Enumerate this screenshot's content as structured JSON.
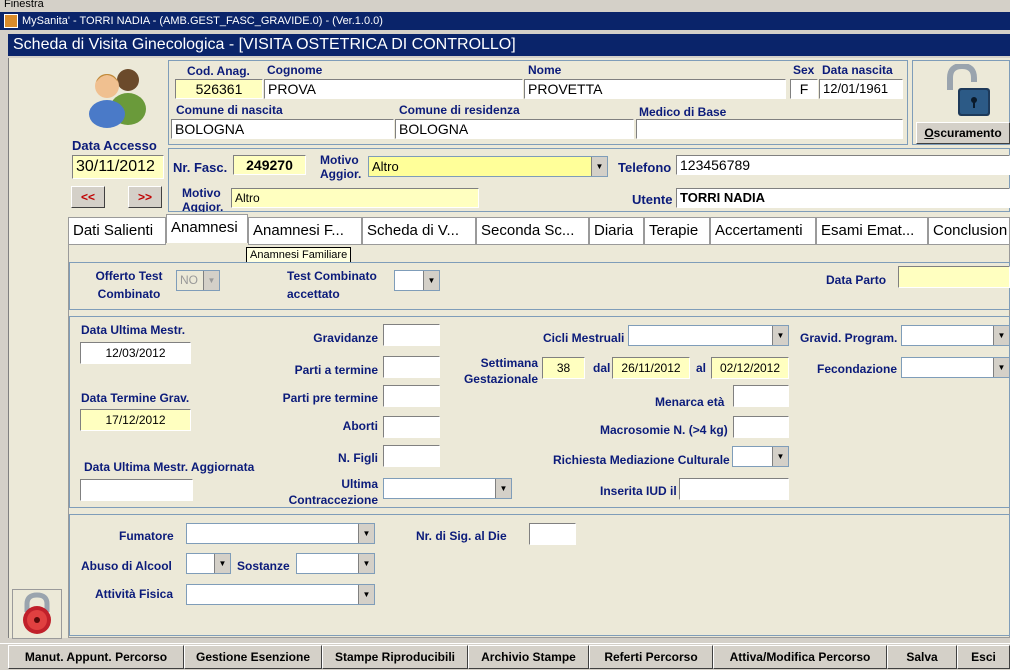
{
  "menu": {
    "first_item": "Finestra"
  },
  "window": {
    "title": "MySanita' - TORRI NADIA - (AMB.GEST_FASC_GRAVIDE.0) - (Ver.1.0.0)"
  },
  "form": {
    "title": "Scheda di Visita Ginecologica - [VISITA OSTETRICA DI CONTROLLO]"
  },
  "patient": {
    "cod_anag_label": "Cod. Anag.",
    "cod_anag": "526361",
    "cognome_label": "Cognome",
    "cognome": "PROVA",
    "nome_label": "Nome",
    "nome": "PROVETTA",
    "sex_label": "Sex",
    "sex": "F",
    "data_nascita_label": "Data nascita",
    "data_nascita": "12/01/1961",
    "comune_nascita_label": "Comune di nascita",
    "comune_nascita": "BOLOGNA",
    "comune_residenza_label": "Comune di residenza",
    "comune_residenza": "BOLOGNA",
    "medico_label": "Medico di Base",
    "medico": ""
  },
  "access": {
    "data_accesso_label": "Data Accesso",
    "data_accesso": "30/11/2012",
    "prev_label": "<<",
    "next_label": ">>"
  },
  "oscuramento": {
    "label": "Oscuramento",
    "underline": "O",
    "rest": "scuramento"
  },
  "fascicolo": {
    "nr_fasc_label": "Nr. Fasc.",
    "nr_fasc": "249270",
    "motivo_aggior_label": "Motivo Aggior.",
    "motivo_aggior_select": "Altro",
    "telefono_label": "Telefono",
    "telefono": "123456789",
    "motivo_aggior_text_label": "Motivo Aggior.",
    "motivo_aggior_text": "Altro",
    "utente_label": "Utente",
    "utente": "TORRI NADIA"
  },
  "tabs": [
    {
      "label": "Dati Salienti"
    },
    {
      "label": "Anamnesi"
    },
    {
      "label": "Anamnesi F..."
    },
    {
      "label": "Scheda di V..."
    },
    {
      "label": "Seconda Sc..."
    },
    {
      "label": "Diaria"
    },
    {
      "label": "Terapie"
    },
    {
      "label": "Accertamenti"
    },
    {
      "label": "Esami Emat..."
    },
    {
      "label": "Conclusion"
    }
  ],
  "tooltip": "Anamnesi Familiare",
  "section1": {
    "offerto_label": "Offerto Test Combinato",
    "offerto_value": "NO",
    "accettato_label": "Test Combinato accettato",
    "accettato_value": "",
    "data_parto_label": "Data Parto",
    "data_parto": ""
  },
  "section2": {
    "dum_label": "Data Ultima Mestr.",
    "dum": "12/03/2012",
    "dtg_label": "Data Termine Grav.",
    "dtg": "17/12/2012",
    "duma_label": "Data Ultima Mestr. Aggiornata",
    "duma": "",
    "gravidanze_label": "Gravidanze",
    "gravidanze": "",
    "parti_termine_label": "Parti a termine",
    "parti_termine": "",
    "parti_pre_label": "Parti pre termine",
    "parti_pre": "",
    "aborti_label": "Aborti",
    "aborti": "",
    "figli_label": "N. Figli",
    "figli": "",
    "contraccezione_label": "Ultima Contraccezione",
    "contraccezione": "",
    "cicli_label": "Cicli Mestruali",
    "cicli": "",
    "settimana_label": "Settimana Gestazionale",
    "settimana": "38",
    "dal_label": "dal",
    "dal": "26/11/2012",
    "al_label": "al",
    "al": "02/12/2012",
    "menarca_label": "Menarca età",
    "menarca": "",
    "macrosomie_label": "Macrosomie N. (>4 kg)",
    "macrosomie": "",
    "mediazione_label": "Richiesta Mediazione Culturale",
    "mediazione": "",
    "iud_label": "Inserita IUD il",
    "iud": "",
    "gravid_program_label": "Gravid. Program.",
    "gravid_program": "",
    "fecondazione_label": "Fecondazione",
    "fecondazione": ""
  },
  "section3": {
    "fumatore_label": "Fumatore",
    "fumatore": "",
    "sigarette_label": "Nr. di Sig. al Die",
    "sigarette": "",
    "alcool_label": "Abuso di Alcool",
    "alcool": "",
    "sostanze_label": "Sostanze",
    "sostanze": "",
    "attivita_label": "Attività Fisica",
    "attivita": ""
  },
  "bottom_buttons": [
    {
      "label": "Manut. Appunt. Percorso"
    },
    {
      "label": "Gestione Esenzione"
    },
    {
      "label": "Stampe Riproducibili"
    },
    {
      "label": "Archivio Stampe"
    },
    {
      "label": "Referti Percorso"
    },
    {
      "label": "Attiva/Modifica Percorso"
    },
    {
      "label": "Salva"
    },
    {
      "label": "Esci"
    }
  ]
}
